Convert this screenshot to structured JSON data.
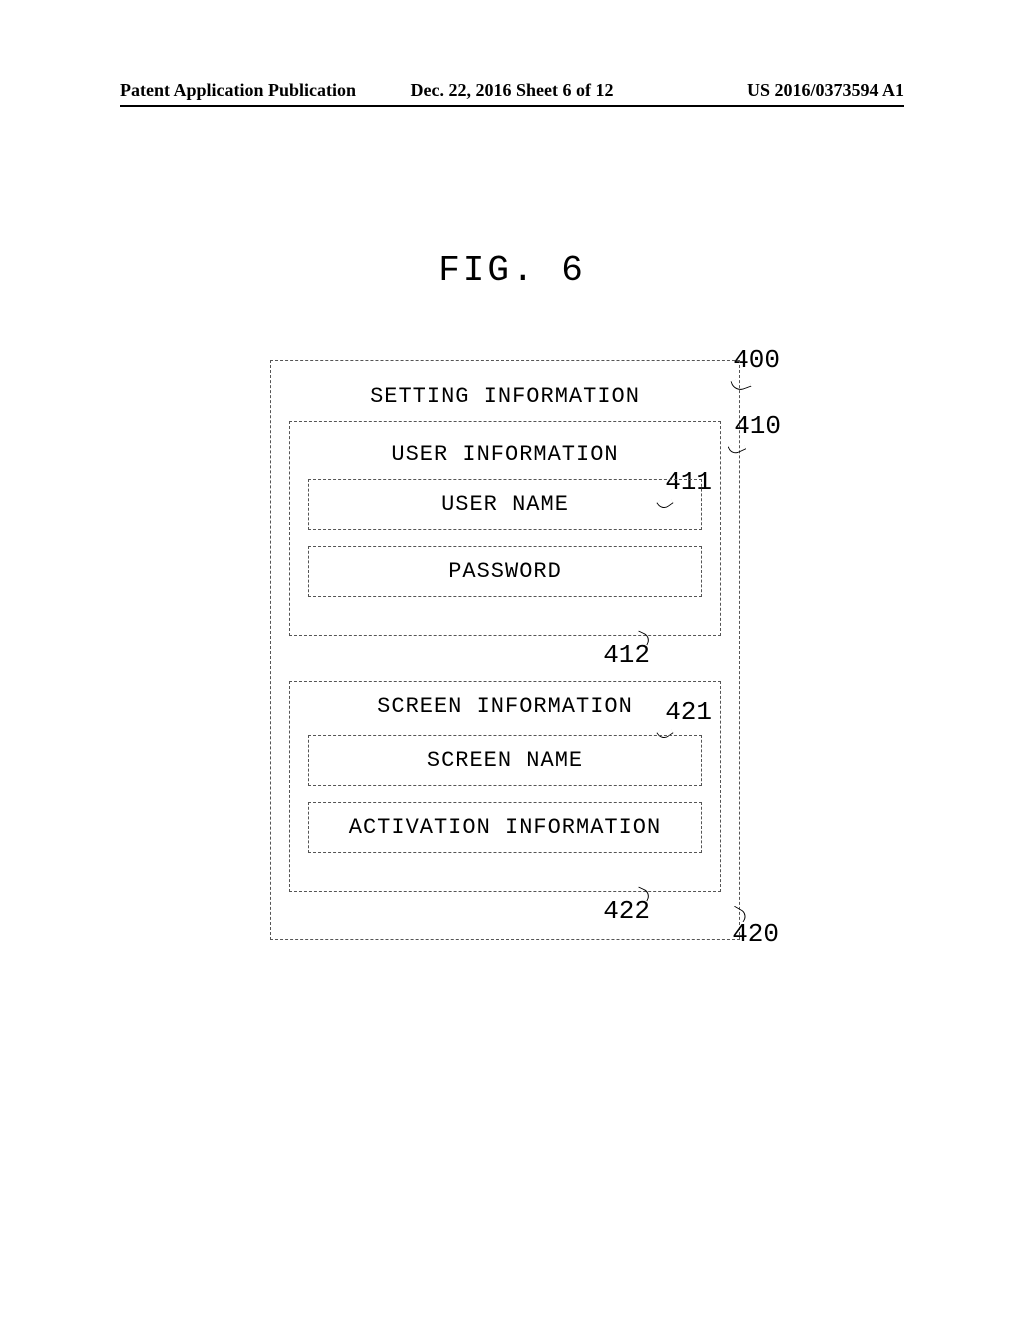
{
  "header": {
    "left": "Patent Application Publication",
    "center": "Dec. 22, 2016  Sheet 6 of 12",
    "right": "US 2016/0373594 A1"
  },
  "figure_label": "FIG. 6",
  "refs": {
    "r400": "400",
    "r410": "410",
    "r411": "411",
    "r412": "412",
    "r420": "420",
    "r421": "421",
    "r422": "422"
  },
  "boxes": {
    "setting_information": "SETTING INFORMATION",
    "user_information": "USER INFORMATION",
    "user_name": "USER NAME",
    "password": "PASSWORD",
    "screen_information": "SCREEN INFORMATION",
    "screen_name": "SCREEN NAME",
    "activation_information": "ACTIVATION INFORMATION"
  }
}
